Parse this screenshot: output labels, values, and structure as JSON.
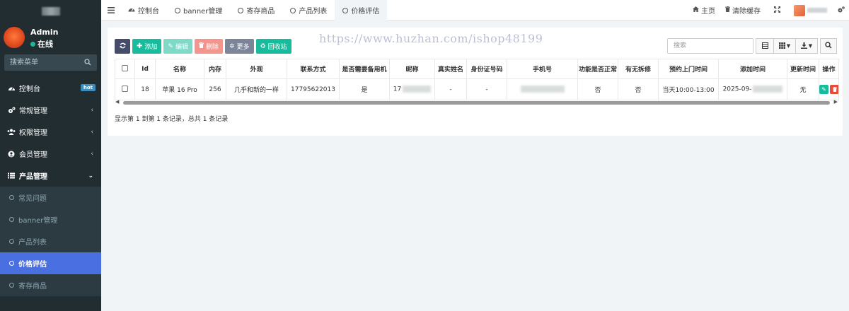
{
  "sidebar": {
    "user": {
      "name": "Admin",
      "status": "在线"
    },
    "search_placeholder": "搜索菜单",
    "menu": [
      {
        "label": "控制台",
        "badge": "hot"
      },
      {
        "label": "常规管理"
      },
      {
        "label": "权限管理"
      },
      {
        "label": "会员管理"
      },
      {
        "label": "产品管理"
      }
    ],
    "submenu": [
      {
        "label": "常见问题"
      },
      {
        "label": "banner管理"
      },
      {
        "label": "产品列表"
      },
      {
        "label": "价格评估"
      },
      {
        "label": "寄存商品"
      }
    ]
  },
  "topbar": {
    "tabs": [
      {
        "label": "控制台",
        "icon": "dashboard-icon"
      },
      {
        "label": "banner管理",
        "icon": "circle-icon"
      },
      {
        "label": "寄存商品",
        "icon": "circle-icon"
      },
      {
        "label": "产品列表",
        "icon": "circle-icon"
      },
      {
        "label": "价格评估",
        "icon": "circle-icon"
      }
    ],
    "home_label": "主页",
    "clear_cache_label": "清除缓存"
  },
  "toolbar": {
    "add_label": "添加",
    "edit_label": "编辑",
    "delete_label": "删除",
    "more_label": "更多",
    "recycle_label": "回收站"
  },
  "table_search_placeholder": "搜索",
  "table": {
    "headers": [
      "Id",
      "名称",
      "内存",
      "外观",
      "联系方式",
      "是否需要备用机",
      "昵称",
      "真实姓名",
      "身份证号码",
      "手机号",
      "功能是否正常",
      "有无拆修",
      "预约上门时间",
      "添加时间",
      "更新时间",
      "操作"
    ],
    "rows": [
      [
        "18",
        "苹果 16 Pro",
        "256",
        "几乎和新的一样",
        "17795622013",
        "是",
        "17",
        "-",
        "-",
        "",
        "否",
        "否",
        "当天10:00-13:00",
        "2025-09-",
        "无",
        ""
      ]
    ]
  },
  "pager_info": "显示第 1 到第 1 条记录，总共 1 条记录",
  "watermark": "https://www.huzhan.com/ishop48199",
  "colors": {
    "sidebar_bg": "#222d32",
    "active_menu": "#4a6fe1",
    "primary_green": "#18bc9c",
    "danger_red": "#e74c3c"
  }
}
